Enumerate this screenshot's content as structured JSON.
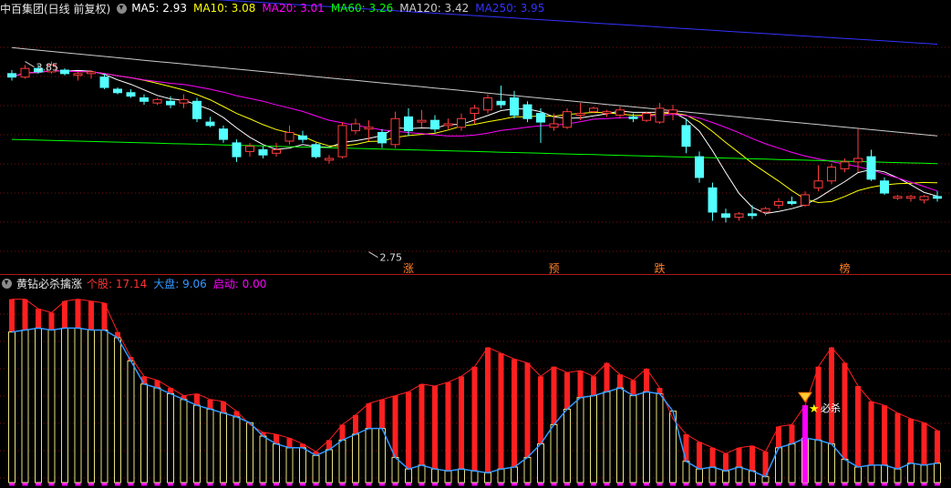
{
  "chart_data": {
    "type": "candlestick",
    "stock_title": "中百集团(日线 前复权)",
    "ma_legend": [
      {
        "label": "MA5:",
        "value": "2.93",
        "color": "#ffffff"
      },
      {
        "label": "MA10:",
        "value": "3.08",
        "color": "#ffff00"
      },
      {
        "label": "MA20:",
        "value": "3.01",
        "color": "#ff00ff"
      },
      {
        "label": "MA60:",
        "value": "3.26",
        "color": "#00ff00"
      },
      {
        "label": "MA120:",
        "value": "3.42",
        "color": "#cccccc"
      },
      {
        "label": "MA250:",
        "value": "3.95",
        "color": "#3333ff"
      }
    ],
    "price_annotations": [
      {
        "text": "3.85",
        "x_index": 1,
        "price": 3.85
      },
      {
        "text": "2.75",
        "x_index": 27,
        "price": 2.75
      }
    ],
    "candles_ohlc": [
      [
        3.78,
        3.8,
        3.74,
        3.76
      ],
      [
        3.76,
        3.83,
        3.75,
        3.81
      ],
      [
        3.81,
        3.83,
        3.78,
        3.79
      ],
      [
        3.79,
        3.85,
        3.78,
        3.83
      ],
      [
        3.8,
        3.81,
        3.77,
        3.78
      ],
      [
        3.77,
        3.79,
        3.74,
        3.78
      ],
      [
        3.78,
        3.8,
        3.75,
        3.79
      ],
      [
        3.76,
        3.78,
        3.69,
        3.7
      ],
      [
        3.69,
        3.7,
        3.66,
        3.67
      ],
      [
        3.67,
        3.69,
        3.64,
        3.65
      ],
      [
        3.64,
        3.66,
        3.6,
        3.62
      ],
      [
        3.61,
        3.64,
        3.6,
        3.63
      ],
      [
        3.62,
        3.65,
        3.58,
        3.6
      ],
      [
        3.61,
        3.66,
        3.58,
        3.63
      ],
      [
        3.62,
        3.64,
        3.5,
        3.52
      ],
      [
        3.5,
        3.53,
        3.47,
        3.48
      ],
      [
        3.46,
        3.48,
        3.38,
        3.4
      ],
      [
        3.38,
        3.4,
        3.27,
        3.3
      ],
      [
        3.33,
        3.38,
        3.3,
        3.36
      ],
      [
        3.34,
        3.36,
        3.29,
        3.31
      ],
      [
        3.32,
        3.38,
        3.3,
        3.34
      ],
      [
        3.39,
        3.48,
        3.37,
        3.44
      ],
      [
        3.42,
        3.45,
        3.38,
        3.4
      ],
      [
        3.37,
        3.38,
        3.29,
        3.3
      ],
      [
        3.28,
        3.31,
        3.26,
        3.29
      ],
      [
        3.3,
        3.5,
        3.29,
        3.48
      ],
      [
        3.45,
        3.52,
        3.43,
        3.49
      ],
      [
        3.46,
        3.51,
        3.39,
        3.47
      ],
      [
        3.44,
        3.46,
        3.35,
        3.38
      ],
      [
        3.37,
        3.56,
        3.35,
        3.52
      ],
      [
        3.53,
        3.58,
        3.42,
        3.45
      ],
      [
        3.5,
        3.57,
        3.47,
        3.51
      ],
      [
        3.51,
        3.54,
        3.44,
        3.46
      ],
      [
        3.48,
        3.52,
        3.46,
        3.49
      ],
      [
        3.47,
        3.55,
        3.45,
        3.52
      ],
      [
        3.55,
        3.6,
        3.49,
        3.58
      ],
      [
        3.57,
        3.66,
        3.55,
        3.64
      ],
      [
        3.62,
        3.71,
        3.58,
        3.6
      ],
      [
        3.64,
        3.68,
        3.52,
        3.54
      ],
      [
        3.6,
        3.62,
        3.5,
        3.52
      ],
      [
        3.55,
        3.58,
        3.38,
        3.5
      ],
      [
        3.47,
        3.55,
        3.45,
        3.49
      ],
      [
        3.47,
        3.58,
        3.46,
        3.56
      ],
      [
        3.54,
        3.61,
        3.51,
        3.55
      ],
      [
        3.56,
        3.59,
        3.55,
        3.58
      ],
      [
        3.55,
        3.57,
        3.53,
        3.56
      ],
      [
        3.54,
        3.59,
        3.52,
        3.57
      ],
      [
        3.53,
        3.55,
        3.5,
        3.52
      ],
      [
        3.51,
        3.56,
        3.5,
        3.55
      ],
      [
        3.5,
        3.61,
        3.49,
        3.58
      ],
      [
        3.55,
        3.6,
        3.51,
        3.57
      ],
      [
        3.48,
        3.52,
        3.32,
        3.36
      ],
      [
        3.3,
        3.33,
        3.15,
        3.18
      ],
      [
        3.12,
        3.15,
        2.93,
        2.98
      ],
      [
        2.97,
        3.0,
        2.92,
        2.95
      ],
      [
        2.95,
        2.98,
        2.93,
        2.97
      ],
      [
        2.97,
        3.02,
        2.94,
        2.96
      ],
      [
        2.98,
        3.01,
        2.96,
        3.0
      ],
      [
        3.02,
        3.06,
        3.0,
        3.04
      ],
      [
        3.04,
        3.07,
        3.02,
        3.03
      ],
      [
        3.02,
        3.1,
        3.01,
        3.08
      ],
      [
        3.12,
        3.25,
        3.1,
        3.16
      ],
      [
        3.16,
        3.26,
        3.14,
        3.24
      ],
      [
        3.23,
        3.29,
        3.21,
        3.27
      ],
      [
        3.27,
        3.46,
        3.21,
        3.29
      ],
      [
        3.3,
        3.34,
        3.16,
        3.17
      ],
      [
        3.16,
        3.18,
        3.08,
        3.09
      ],
      [
        3.06,
        3.08,
        3.05,
        3.07
      ],
      [
        3.06,
        3.08,
        3.04,
        3.07
      ],
      [
        3.05,
        3.08,
        3.03,
        3.07
      ],
      [
        3.07,
        3.1,
        3.04,
        3.06
      ]
    ],
    "indicator_title": "黄钻必杀擒涨",
    "indicator_legend": [
      {
        "label": "个股:",
        "value": "17.14",
        "color": "#ff3333"
      },
      {
        "label": "大盘:",
        "value": "9.06",
        "color": "#3399ff"
      },
      {
        "label": "启动:",
        "value": "0.00",
        "color": "#ff00ff"
      }
    ],
    "signal_marks": [
      {
        "text": "涨",
        "x_index": 30
      },
      {
        "text": "预",
        "x_index": 41
      },
      {
        "text": "跌",
        "x_index": 49
      },
      {
        "text": "榜",
        "x_index": 63
      }
    ],
    "kill_label": "必杀",
    "kill_index": 60,
    "stock_line": [
      95,
      95,
      90,
      88,
      94,
      95,
      94,
      93,
      78,
      65,
      55,
      53,
      49,
      45,
      46,
      43,
      42,
      37,
      30,
      26,
      25,
      23,
      20,
      16,
      22,
      30,
      35,
      41,
      43,
      45,
      47,
      51,
      50,
      52,
      55,
      60,
      70,
      67,
      64,
      62,
      55,
      60,
      57,
      58,
      55,
      62,
      56,
      53,
      59,
      49,
      33,
      25,
      21,
      18,
      15,
      18,
      19,
      16,
      29,
      30,
      40,
      60,
      70,
      62,
      50,
      42,
      40,
      36,
      33,
      31,
      27
    ],
    "market_line": [
      78,
      79,
      80,
      79,
      80,
      80,
      79,
      79,
      75,
      63,
      51,
      49,
      46,
      43,
      40,
      38,
      36,
      34,
      31,
      24,
      20,
      18,
      18,
      14,
      17,
      22,
      25,
      28,
      28,
      13,
      7,
      9,
      7,
      6,
      7,
      6,
      5,
      7,
      8,
      13,
      20,
      30,
      38,
      44,
      45,
      47,
      49,
      45,
      47,
      46,
      37,
      11,
      7,
      8,
      6,
      8,
      6,
      3,
      18,
      20,
      23,
      22,
      20,
      12,
      8,
      9,
      9,
      7,
      10,
      9,
      10
    ]
  }
}
